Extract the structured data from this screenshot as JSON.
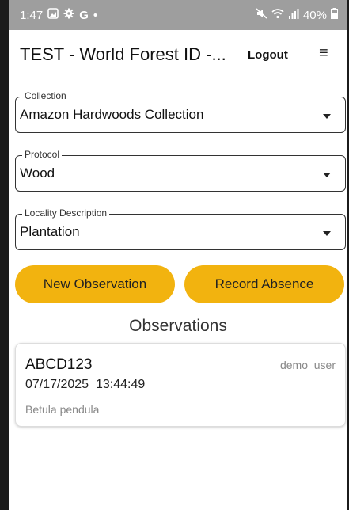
{
  "status_bar": {
    "time": "1:47",
    "battery": "40%"
  },
  "appbar": {
    "title": "TEST - World Forest ID -...",
    "logout_label": "Logout",
    "menu_icon": "≡"
  },
  "fields": [
    {
      "label": "Collection",
      "value": "Amazon Hardwoods Collection"
    },
    {
      "label": "Protocol",
      "value": "Wood"
    },
    {
      "label": "Locality Description",
      "value": "Plantation"
    }
  ],
  "buttons": {
    "new_observation": "New Observation",
    "record_absence": "Record Absence"
  },
  "observations_title": "Observations",
  "observations": [
    {
      "id": "ABCD123",
      "user": "demo_user",
      "date": "07/17/2025",
      "time": "13:44:49",
      "species": "Betula pendula"
    }
  ],
  "colors": {
    "accent": "#f2b30f",
    "status_bar": "#9e9e9e"
  }
}
